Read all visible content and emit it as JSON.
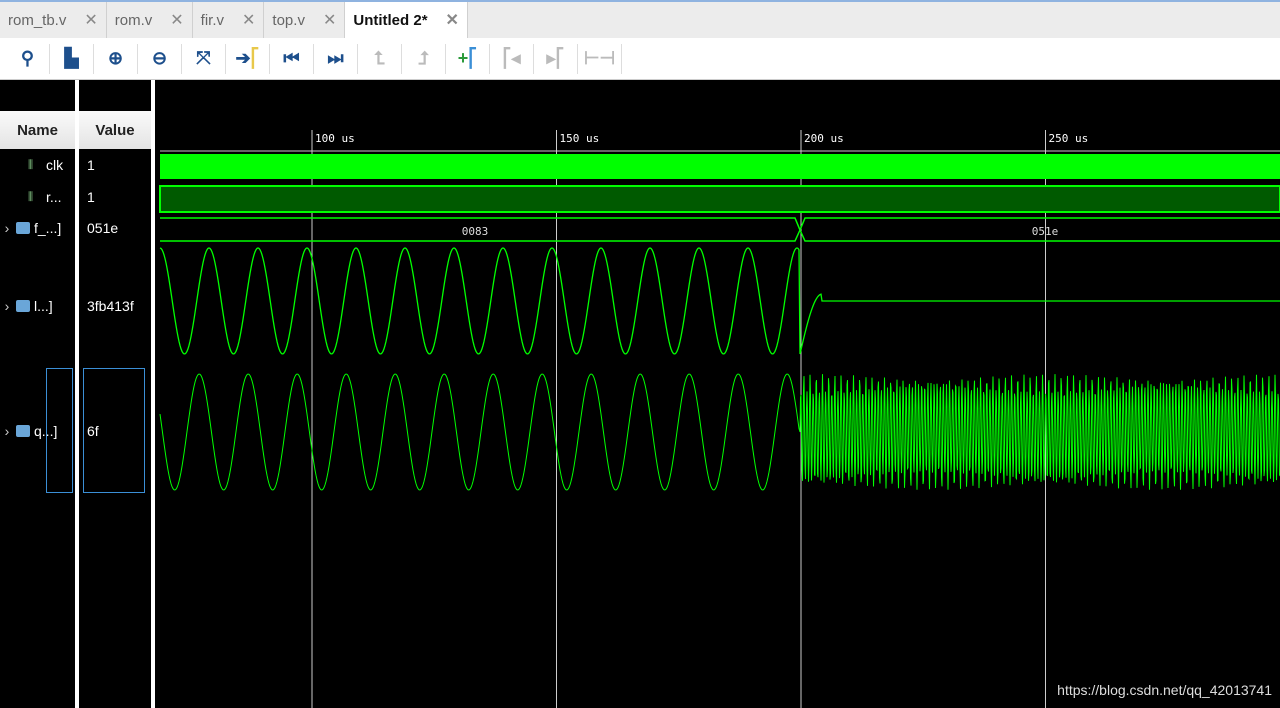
{
  "tabs": [
    {
      "label": "rom_tb.v"
    },
    {
      "label": "rom.v"
    },
    {
      "label": "fir.v"
    },
    {
      "label": "top.v"
    },
    {
      "label": "Untitled 2*",
      "active": true
    }
  ],
  "toolbar": [
    "search-icon",
    "save-icon",
    "zoom-in-icon",
    "zoom-out-icon",
    "zoom-fit-icon",
    "go-to-cursor-icon",
    "go-to-start-icon",
    "go-to-end-icon",
    "previous-transition-icon",
    "next-transition-icon",
    "add-marker-icon",
    "previous-marker-icon",
    "next-marker-icon",
    "swap-cursors-icon"
  ],
  "columns": {
    "name": "Name",
    "value": "Value"
  },
  "signals": [
    {
      "name": "clk",
      "value": "1",
      "type": "bit"
    },
    {
      "name": "r...",
      "value": "1",
      "type": "bit"
    },
    {
      "name": "f_...]",
      "value": "051e",
      "type": "bus"
    },
    {
      "name": "l...]",
      "value": "3fb413f",
      "type": "bus"
    },
    {
      "name": "q...]",
      "value": "6f",
      "type": "bus"
    }
  ],
  "time_axis": {
    "ticks": [
      "100 us",
      "150 us",
      "200 us",
      "250 us"
    ]
  },
  "bus_values": [
    "0083",
    "051e"
  ],
  "colors": {
    "wave": "#00ff00",
    "bg": "#000000",
    "grid": "#cccccc"
  },
  "watermark": "https://blog.csdn.net/qq_42013741"
}
